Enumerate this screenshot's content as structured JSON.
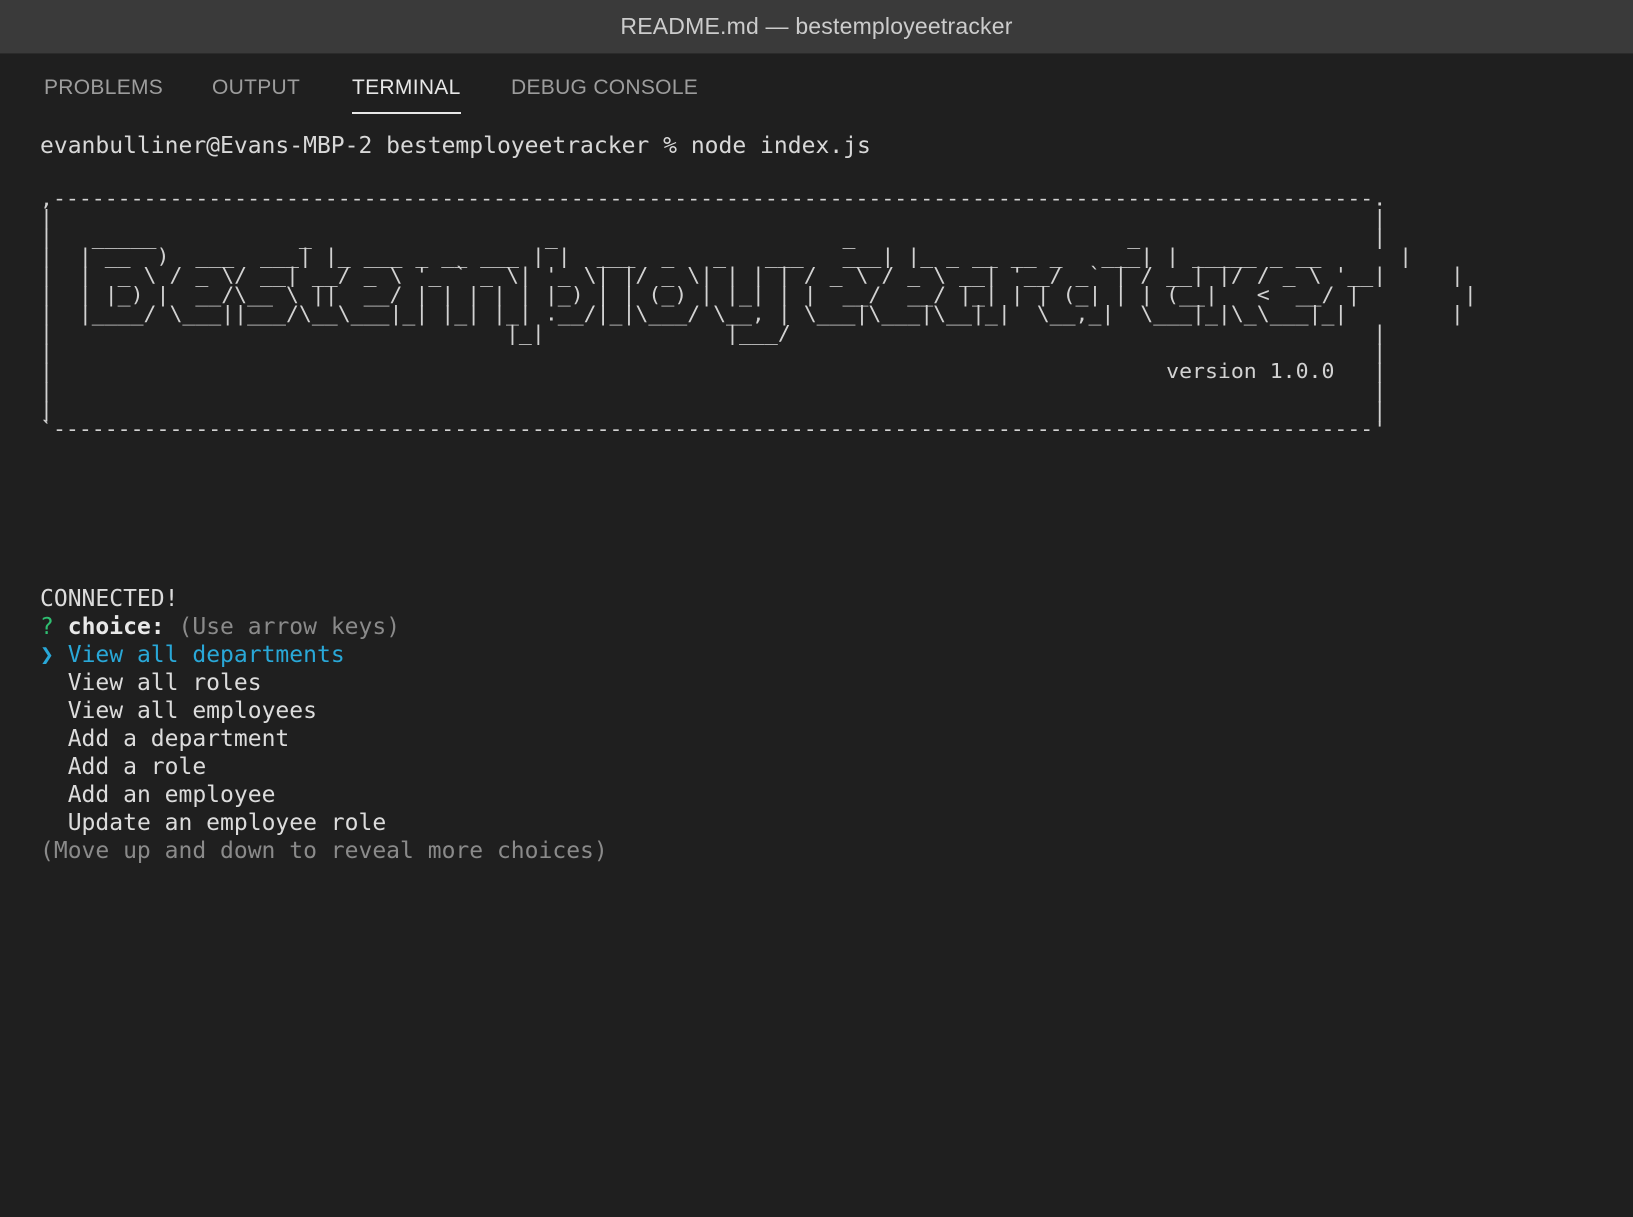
{
  "window": {
    "title": "README.md — bestemployeetracker"
  },
  "panel": {
    "tabs": [
      {
        "label": "PROBLEMS"
      },
      {
        "label": "OUTPUT"
      },
      {
        "label": "TERMINAL"
      },
      {
        "label": "DEBUG CONSOLE"
      }
    ],
    "active_tab": "TERMINAL"
  },
  "terminal": {
    "prompt_command": "evanbulliner@Evans-MBP-2 bestemployeetracker % node index.js",
    "banner_ascii": ",------------------------------------------------------------------------------------------------------.\n|                                                                                                      |\n|   _____           _                  _                      _                     _                  |\n|  | __  )  ___  ___| |_ ___ _ __ ___ | |  ___  _   _   ___   ___| |_ _ __ __ _   ___| | _____ _ __      |\n|  |  _ \\ / _ \\/ __| __/ _ \\ '_ ` _ \\| '_ \\| |/ _ \\| | | | / _ \\ / _ \\ __| '__/ _` | / __| |/ / _ \\ '__|     |\n|  | |_) |  __/\\__ \\ ||  __/ | | | | | |_) | | (_) | |_| | |  __/  __/ |_| | | (_| | | (__|   <  __/ |        |\n|  |____/ \\___||___/\\__\\___|_| |_| |_| .__/|_|\\___/ \\__, | \\___|\\___|\\__|_|  \\__,_|  \\___|_|\\_\\___|_|        |\n|                                   |_|              |___/                                             |\n|                                                                                                      |\n|                                                                                      version 1.0.0   |\n|                                                                                                      |\n|                                                                                                      |\n`------------------------------------------------------------------------------------------------------'",
    "status": "CONNECTED!",
    "question": {
      "mark": "?",
      "name": "choice:",
      "hint": "(Use arrow keys)"
    },
    "pointer": "❯",
    "choices": [
      "View all departments",
      "View all roles",
      "View all employees",
      "Add a department",
      "Add a role",
      "Add an employee",
      "Update an employee role"
    ],
    "selected_index": 0,
    "more_hint": "(Move up and down to reveal more choices)"
  },
  "colors": {
    "background": "#1f1f1f",
    "titlebar": "#3a3a3a",
    "selected": "#29a8d8",
    "question_mark": "#2fbf71"
  }
}
